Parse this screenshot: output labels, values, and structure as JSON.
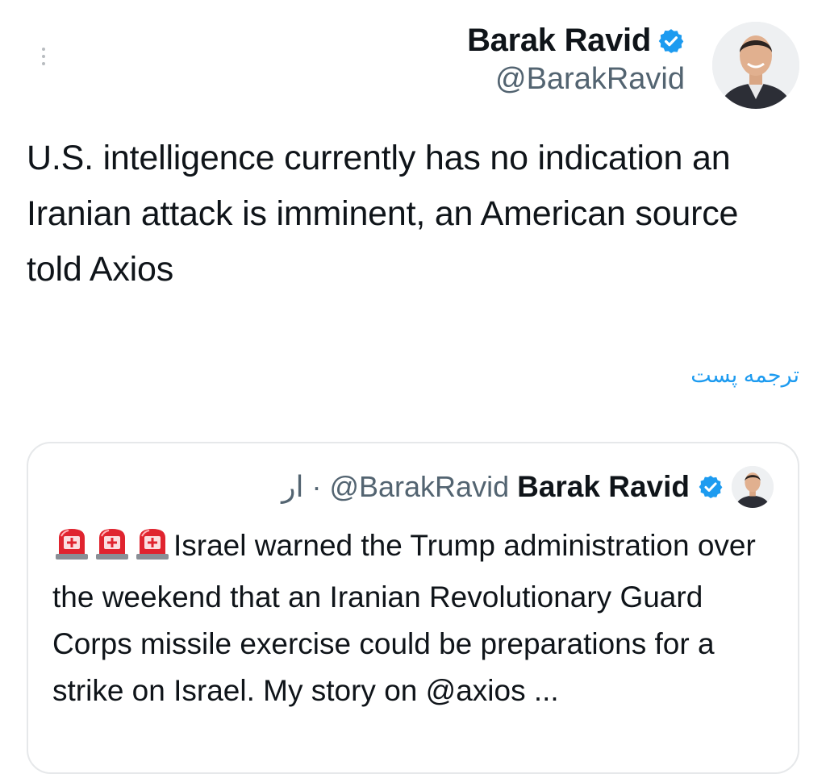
{
  "tweet": {
    "author_name": "Barak Ravid",
    "handle": "@BarakRavid",
    "text": "U.S. intelligence currently has no indication an Iranian attack is imminent, an American source told Axios",
    "translate_label": "ترجمه پست"
  },
  "quoted_tweet": {
    "author_name": "Barak Ravid",
    "handle": "@BarakRavid",
    "separator": "·",
    "time": "ار",
    "emoji_count": 3,
    "text": "Israel warned the Trump administration over the weekend that an Iranian Revolutionary Guard Corps missile exercise could be preparations for a strike on Israel. My story on @axios ..."
  },
  "icons": {
    "more": "more-vertical-icon",
    "verified": "verified-badge-icon",
    "siren": "police-light-emoji"
  },
  "colors": {
    "verified": "#1d9bf0",
    "link": "#1d9bf0",
    "secondary_text": "#536471",
    "primary_text": "#0f1419",
    "siren": "#e0242f"
  }
}
